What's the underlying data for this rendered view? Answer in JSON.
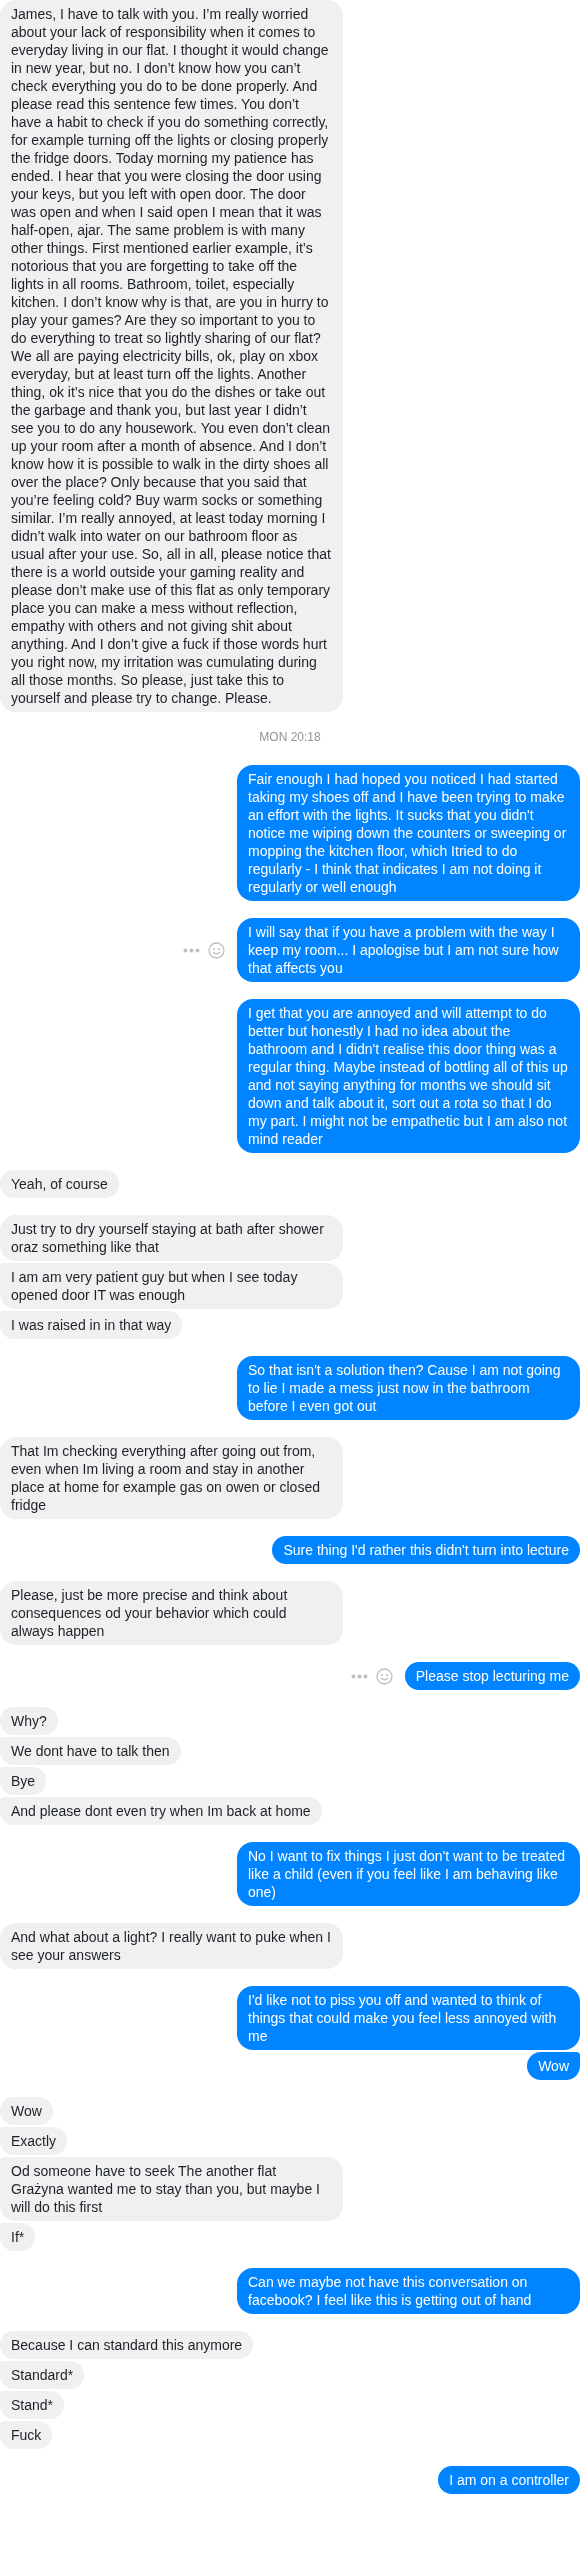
{
  "items": [
    {
      "kind": "received",
      "grouped": false,
      "actions": false,
      "text": "James, I have to talk with you. I’m really worried about your lack of responsibility when it comes to everyday living in our flat. I thought it would change in new year, but no. I don’t know how you can’t check everything you do to be done properly. And please read this sentence few times. You don’t have a habit to check if you do something correctly, for example turning off the lights or closing properly the fridge doors. Today morning my patience has ended. I hear that you were closing the door using your keys, but you left with open door. The door was open and when I said open I mean that it was half-open, ajar. The same problem is with many other things. First mentioned earlier example, it’s notorious that you are forgetting to take off the lights in all rooms. Bathroom, toilet, especially kitchen. I don’t know why is that, are you in hurry to play your games? Are they so important to you to do everything to treat so lightly sharing of our flat? We all are paying electricity bills, ok, play on xbox everyday, but at least turn off the lights. Another thing, ok it’s nice that you do the dishes or take out the garbage and thank you, but last year I didn’t see you to do any housework. You even don’t clean up your room after a month of absence. And I don’t know how it is possible to walk in the dirty shoes all over the place? Only because that you said that you’re feeling cold? Buy warm socks or something similar. I’m really annoyed, at least today morning I didn’t walk into water on our bathroom floor as usual after your use. So, all in all, please notice that there is a world outside your gaming reality and please don’t make use of this flat as only temporary place you can make a mess without reflection, empathy with others and not giving shit about anything. And I don’t give a fuck if those words hurt you right now, my irritation was cumulating during all those months. So please, just take this to yourself and please try to change. Please."
    },
    {
      "kind": "timestamp",
      "text": "MON 20:18"
    },
    {
      "kind": "sent",
      "grouped": false,
      "actions": false,
      "text": "Fair enough I had hoped you noticed I had started taking my shoes off and I have been trying to make an effort with the lights. It sucks that you didn't notice me wiping down the counters or sweeping or mopping the kitchen floor, which Itried to do regularly - I think that indicates I am not doing it regularly or well enough"
    },
    {
      "kind": "sent",
      "grouped": false,
      "actions": true,
      "text": "I will say that if you have a problem with the way I keep my room... I apologise but I am not sure how that affects you"
    },
    {
      "kind": "sent",
      "grouped": false,
      "actions": false,
      "text": "I get that you are annoyed and will attempt to do better but honestly I had no idea about the bathroom and I didn't realise this door thing was a regular thing. Maybe instead of bottling all of this up and not saying anything for months we should sit down and talk about it, sort out a rota so that I do my part. I might not be empathetic but I am also not mind reader"
    },
    {
      "kind": "received",
      "grouped": false,
      "actions": false,
      "text": "Yeah, of course"
    },
    {
      "kind": "received",
      "grouped": false,
      "actions": false,
      "text": "Just try to dry yourself staying at bath after shower oraz something like that"
    },
    {
      "kind": "received",
      "grouped": true,
      "actions": false,
      "text": "I am am very patient guy but when I see today opened door IT was enough"
    },
    {
      "kind": "received",
      "grouped": true,
      "actions": false,
      "text": "I was raised in in that way"
    },
    {
      "kind": "sent",
      "grouped": false,
      "actions": false,
      "text": "So that isn't a solution then? Cause I am not going to lie I made a mess just now in the bathroom before I even got out"
    },
    {
      "kind": "received",
      "grouped": false,
      "actions": false,
      "text": "That Im checking everything after going out from, even when Im living a room and stay in another place at home for example gas on owen or closed fridge"
    },
    {
      "kind": "sent",
      "grouped": false,
      "actions": false,
      "text": "Sure thing I'd rather this didn't turn into lecture"
    },
    {
      "kind": "received",
      "grouped": false,
      "actions": false,
      "text": "Please, just be more precise and think about consequences od your behavior which could always happen"
    },
    {
      "kind": "sent",
      "grouped": false,
      "actions": true,
      "text": "Please stop lecturing me"
    },
    {
      "kind": "received",
      "grouped": false,
      "actions": false,
      "text": "Why?"
    },
    {
      "kind": "received",
      "grouped": true,
      "actions": false,
      "text": "We dont have to talk then"
    },
    {
      "kind": "received",
      "grouped": true,
      "actions": false,
      "text": "Bye"
    },
    {
      "kind": "received",
      "grouped": true,
      "actions": false,
      "text": "And please dont even try when Im back at home"
    },
    {
      "kind": "sent",
      "grouped": false,
      "actions": false,
      "text": "No I want to fix things I just don't want to be treated like a child (even if you feel like I am behaving like one)"
    },
    {
      "kind": "received",
      "grouped": false,
      "actions": false,
      "text": "And what about a light? I really want to puke when I see your answers"
    },
    {
      "kind": "sent",
      "grouped": false,
      "actions": false,
      "text": "I'd like not to piss you off and wanted to think of things that could make you feel less annoyed with me"
    },
    {
      "kind": "sent",
      "grouped": true,
      "actions": false,
      "text": "Wow"
    },
    {
      "kind": "received",
      "grouped": false,
      "actions": false,
      "text": "Wow"
    },
    {
      "kind": "received",
      "grouped": true,
      "actions": false,
      "text": "Exactly"
    },
    {
      "kind": "received",
      "grouped": true,
      "actions": false,
      "text": "Od someone have to seek The another flat Grażyna wanted me to stay than you, but maybe I will do this first"
    },
    {
      "kind": "received",
      "grouped": true,
      "actions": false,
      "text": "If*"
    },
    {
      "kind": "sent",
      "grouped": false,
      "actions": false,
      "text": "Can we maybe not have this conversation on facebook? I feel like this is getting out of hand"
    },
    {
      "kind": "received",
      "grouped": false,
      "actions": false,
      "text": "Because I can standard this anymore"
    },
    {
      "kind": "received",
      "grouped": true,
      "actions": false,
      "text": "Standard*"
    },
    {
      "kind": "received",
      "grouped": true,
      "actions": false,
      "text": "Stand*"
    },
    {
      "kind": "received",
      "grouped": true,
      "actions": false,
      "text": "Fuck"
    },
    {
      "kind": "sent",
      "grouped": false,
      "actions": false,
      "text": "I am on a controller"
    }
  ]
}
